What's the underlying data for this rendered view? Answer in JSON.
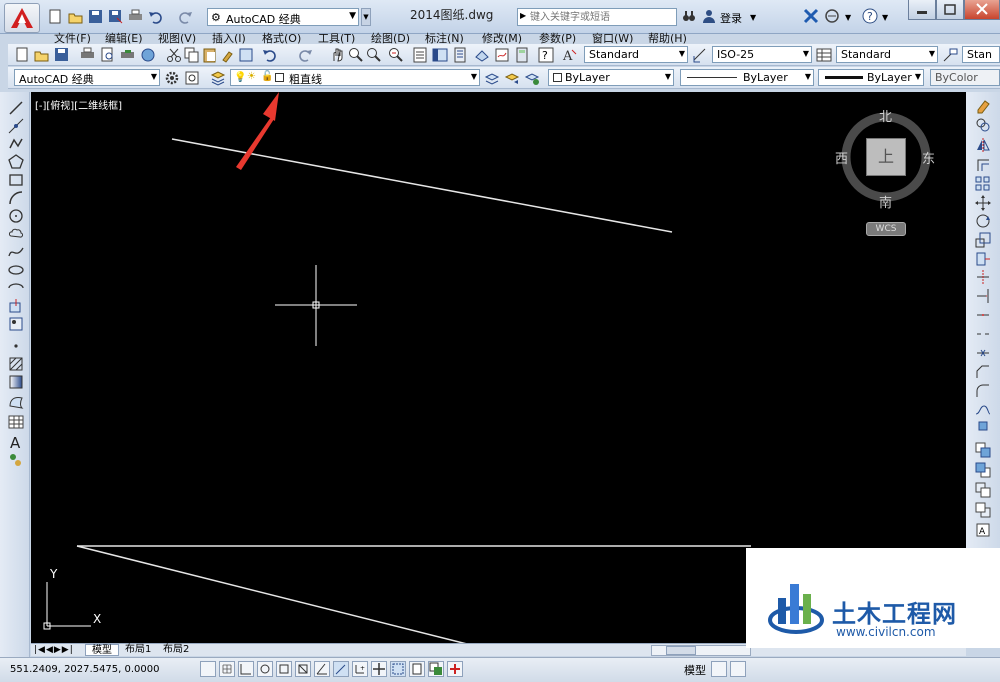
{
  "title_bar": {
    "workspace": "AutoCAD 经典",
    "file_title": "2014图纸.dwg",
    "search_placeholder": "键入关键字或短语",
    "login": "登录"
  },
  "menu": [
    "文件(F)",
    "编辑(E)",
    "视图(V)",
    "插入(I)",
    "格式(O)",
    "工具(T)",
    "绘图(D)",
    "标注(N)",
    "修改(M)",
    "参数(P)",
    "窗口(W)",
    "帮助(H)"
  ],
  "toolbar1": {
    "text_style": "Standard",
    "dim_style": "ISO-25",
    "table_style": "Standard",
    "multileader_style": "Stan"
  },
  "toolbar2": {
    "workspace": "AutoCAD 经典",
    "layer": "粗直线",
    "color": "ByLayer",
    "linetype": "ByLayer",
    "lineweight": "ByLayer",
    "plot_style": "ByColor"
  },
  "canvas": {
    "viewport_label": "[-][俯视][二维线框]",
    "viewcube": {
      "north": "北",
      "south": "南",
      "east": "东",
      "west": "西",
      "top": "上",
      "wcs": "WCS"
    },
    "ucs": {
      "x": "X",
      "y": "Y"
    }
  },
  "layout_tabs": [
    "模型",
    "布局1",
    "布局2"
  ],
  "status": {
    "coords": "551.2409, 2027.5475, 0.0000",
    "mode": "模型"
  },
  "watermark": {
    "name": "土木工程网",
    "url": "www.civilcn.com"
  },
  "colors": {
    "accent_arrow": "#e8392f",
    "canvas": "#000000",
    "watermark_blue": "#1e5aa8"
  }
}
